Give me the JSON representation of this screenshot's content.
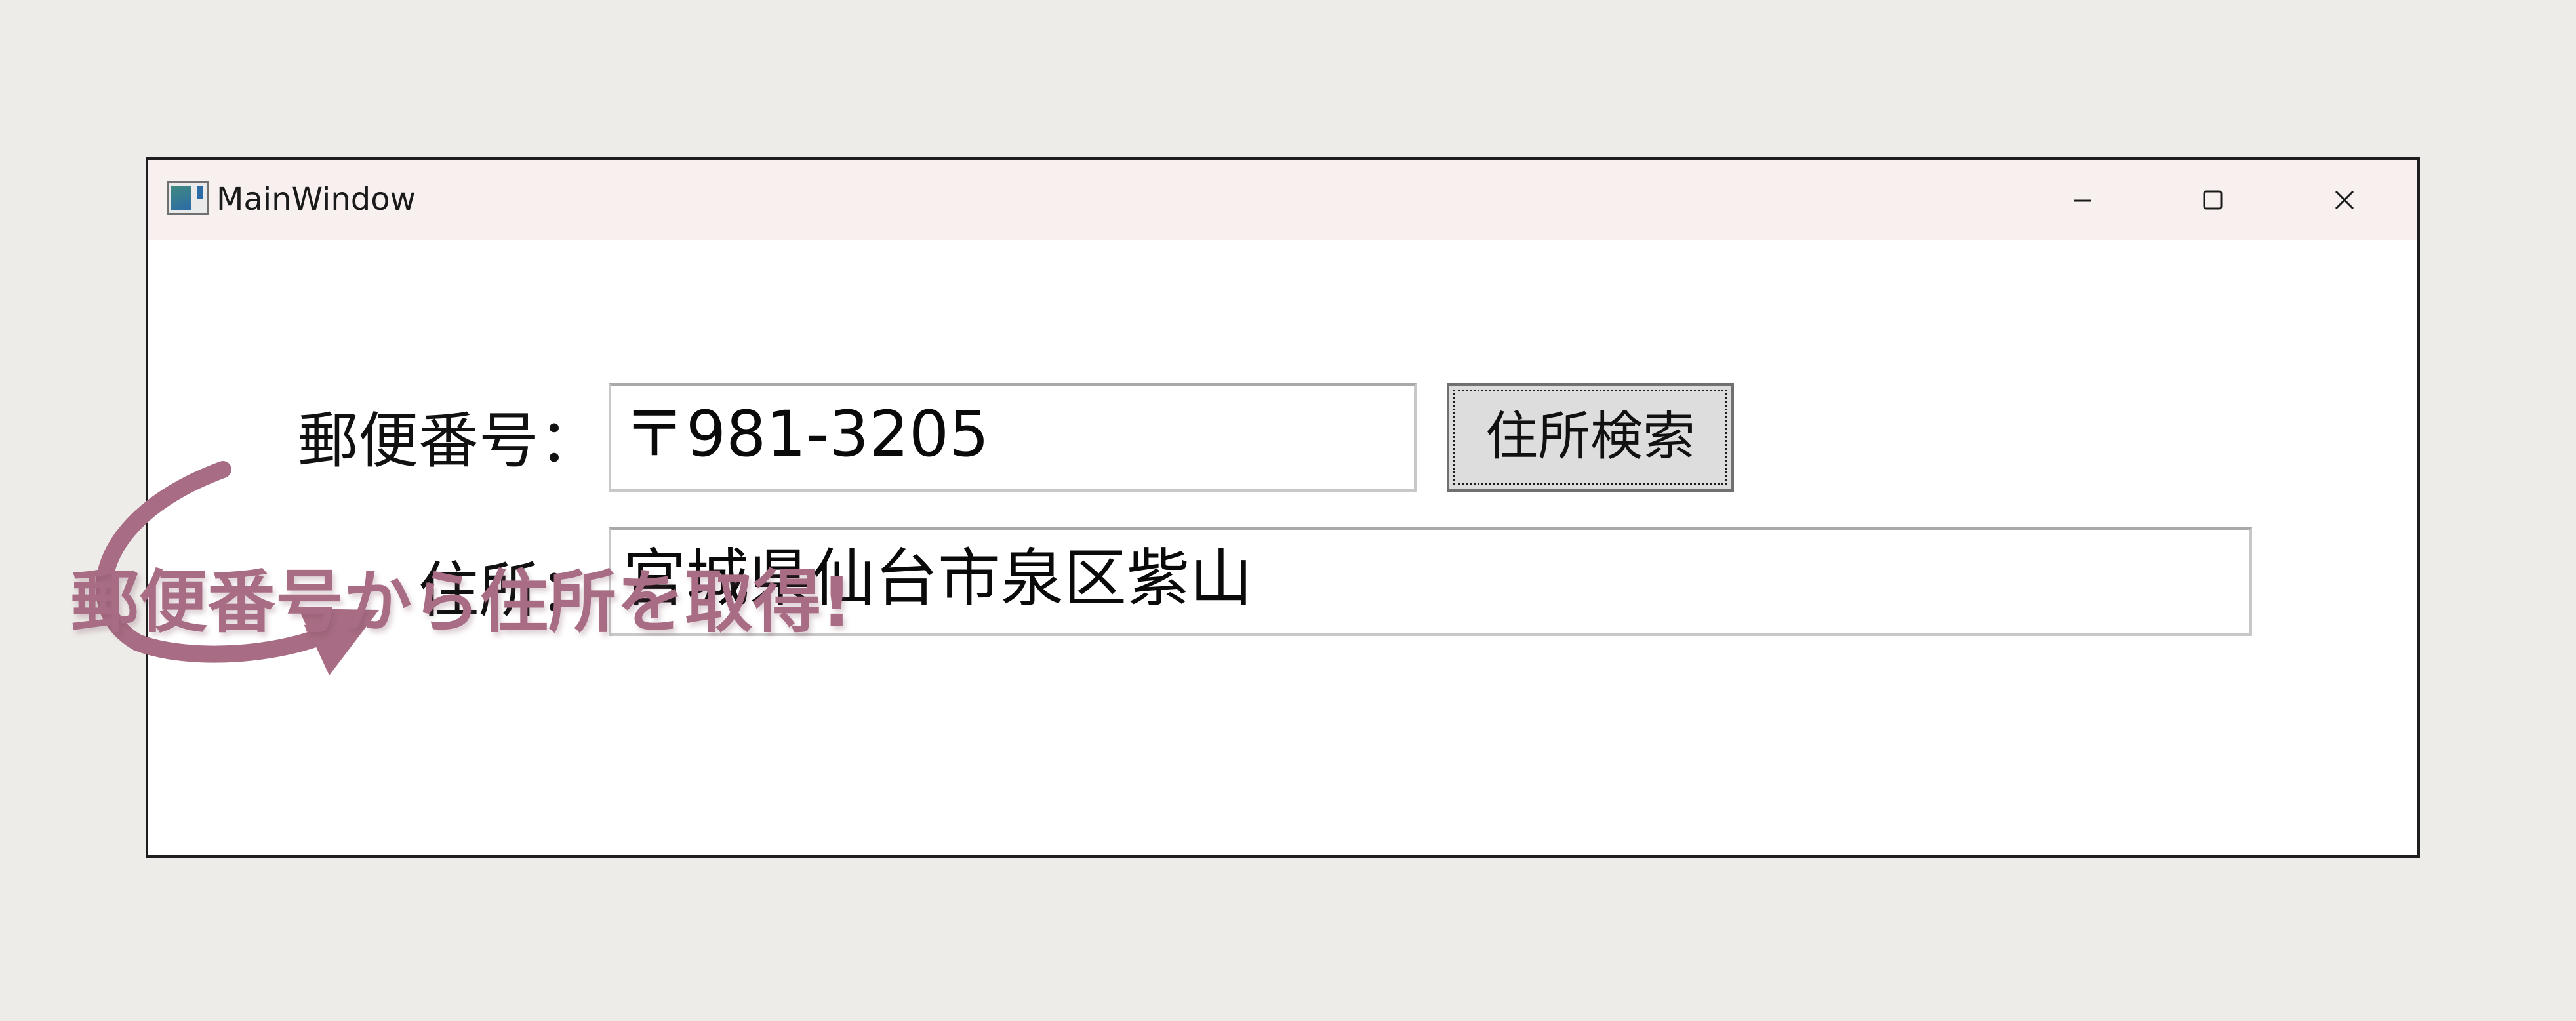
{
  "window": {
    "title": "MainWindow",
    "icon": "app-window-icon"
  },
  "caption_buttons": {
    "minimize_icon": "minimize-icon",
    "maximize_icon": "maximize-icon",
    "close_icon": "close-icon"
  },
  "form": {
    "postal_label": "郵便番号：",
    "postal_value": "〒981-3205",
    "search_button_label": "住所検索",
    "address_label": "住所：",
    "address_value": "宮城県仙台市泉区紫山"
  },
  "annotation": {
    "text": "郵便番号から住所を取得!",
    "color": "#a86d84",
    "arrow_icon": "curved-arrow-icon"
  }
}
